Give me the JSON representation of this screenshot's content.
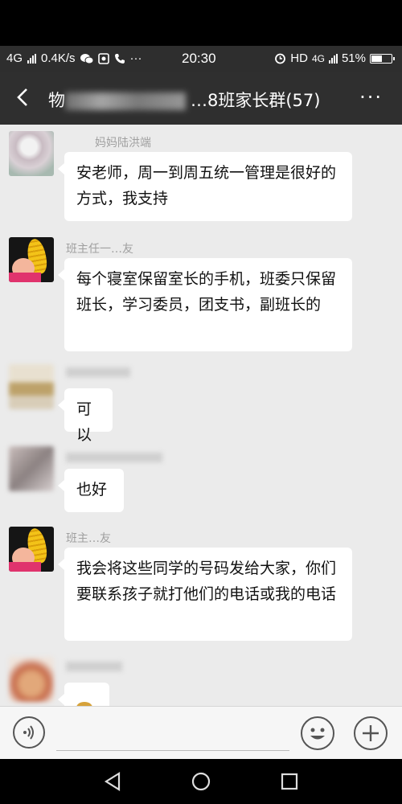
{
  "status_bar": {
    "network": "4G",
    "speed": "0.4K/s",
    "time": "20:30",
    "hd_label": "HD",
    "network_right": "4G",
    "battery": "51%",
    "battery_level": 0.51
  },
  "title_bar": {
    "title_visible": "…8班家长群(57)",
    "title_prefix_fragment": "物",
    "more_label": "···"
  },
  "messages": [
    {
      "sender": "妈妈陆洪端",
      "text": "安老师，周一到周五统一管理是很好的方式，我支持"
    },
    {
      "sender": "班主任一…友",
      "text": "每个寝室保留室长的手机，班委只保留班长，学习委员，团支书，副班长的"
    },
    {
      "sender": "",
      "text": "可以"
    },
    {
      "sender": "",
      "text": "也好"
    },
    {
      "sender": "班主…友",
      "text": "我会将这些同学的号码发给大家，你们要联系孩子就打他们的电话或我的电话"
    }
  ],
  "input_bar": {
    "voice_icon": "voice-icon",
    "emoji_icon": "emoji-icon",
    "plus_icon": "plus-icon"
  },
  "nav_bar": {
    "back": "triangle-back-icon",
    "home": "circle-home-icon",
    "recent": "square-recent-icon"
  }
}
